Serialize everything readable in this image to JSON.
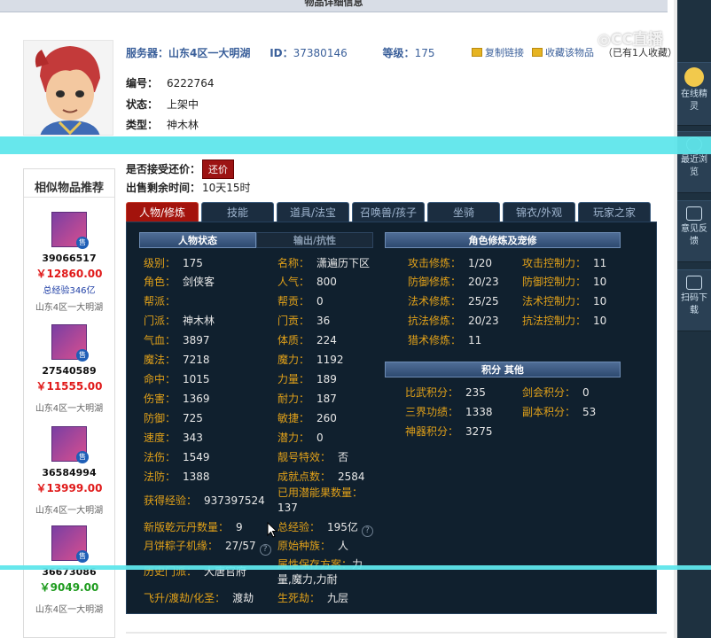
{
  "header": {
    "title": "物品详细信息"
  },
  "meta": {
    "server_label": "服务器：",
    "server": "山东4区一大明湖",
    "id_label": "ID：",
    "id": "37380146",
    "level_label": "等级：",
    "level": "175",
    "copy_link": "复制链接",
    "favorite": "收藏该物品",
    "favorite_count": "（已有1人收藏）"
  },
  "info": {
    "number_label": "编号：",
    "number": "6222764",
    "status_label": "状态：",
    "status": "上架中",
    "type_label": "类型：",
    "type": "神木林",
    "bargain_label": "是否接受还价：",
    "bargain_button": "还价",
    "remaining_label": "出售剩余时间：",
    "remaining": "10天15时"
  },
  "sidebar": {
    "title": "相似物品推荐",
    "items": [
      {
        "id": "39066517",
        "price": "￥12860.00",
        "exp": "总经验346亿",
        "server": "山东4区一大明湖",
        "price_color": "#e01a1a"
      },
      {
        "id": "27540589",
        "price": "￥11555.00",
        "exp": "",
        "server": "山东4区一大明湖",
        "price_color": "#e01a1a"
      },
      {
        "id": "36584994",
        "price": "￥13999.00",
        "exp": "",
        "server": "山东4区一大明湖",
        "price_color": "#e01a1a"
      },
      {
        "id": "36673086",
        "price": "￥9049.00",
        "exp": "",
        "server": "山东4区一大明湖",
        "price_color": "#1d9b1d"
      }
    ],
    "sell_badge": "售"
  },
  "tabs": [
    "人物/修炼",
    "技能",
    "道具/法宝",
    "召唤兽/孩子",
    "坐骑",
    "锦衣/外观",
    "玩家之家"
  ],
  "subtabs": {
    "character": "人物状态",
    "output": "输出/抗性",
    "cultivation": "角色修炼及宠修",
    "points": "积分 其他"
  },
  "character": {
    "left": [
      {
        "k": "级别：",
        "v": "175"
      },
      {
        "k": "角色：",
        "v": "剑侠客"
      },
      {
        "k": "帮派：",
        "v": ""
      },
      {
        "k": "门派：",
        "v": "神木林"
      },
      {
        "k": "气血：",
        "v": "3897"
      },
      {
        "k": "魔法：",
        "v": "7218"
      },
      {
        "k": "命中：",
        "v": "1015"
      },
      {
        "k": "伤害：",
        "v": "1369"
      },
      {
        "k": "防御：",
        "v": "725"
      },
      {
        "k": "速度：",
        "v": "343"
      },
      {
        "k": "法伤：",
        "v": "1549"
      },
      {
        "k": "法防：",
        "v": "1388"
      }
    ],
    "right": [
      {
        "k": "名称：",
        "v": "潇遍历下区"
      },
      {
        "k": "人气：",
        "v": "800"
      },
      {
        "k": "帮贡：",
        "v": "0"
      },
      {
        "k": "门贡：",
        "v": "36"
      },
      {
        "k": "体质：",
        "v": "224"
      },
      {
        "k": "魔力：",
        "v": "1192"
      },
      {
        "k": "力量：",
        "v": "189"
      },
      {
        "k": "耐力：",
        "v": "187"
      },
      {
        "k": "敏捷：",
        "v": "260"
      },
      {
        "k": "潜力：",
        "v": "0"
      },
      {
        "k": "靓号特效：",
        "v": "否"
      },
      {
        "k": "成就点数：",
        "v": "2584"
      }
    ],
    "exp_k": "获得经验：",
    "exp_v": "937397524",
    "potential_k": "已用潜能果数量：",
    "potential_v": "137",
    "qianyuan_k": "新版乾元丹数量：",
    "qianyuan_v": "9",
    "total_exp_k": "总经验：",
    "total_exp_v": "195亿",
    "zongzi_k": "月饼粽子机缘：",
    "zongzi_v": "27/57",
    "race_k": "原始种族：",
    "race_v": "人",
    "history_k": "历史门派：",
    "history_v": "大唐官府",
    "attr_k": "属性保存方案：",
    "attr_v": "力量,魔力,力耐",
    "fly_k": "飞升/渡劫/化圣：",
    "fly_v": "渡劫",
    "life_k": "生死劫：",
    "life_v": "九层"
  },
  "cultivation": {
    "left": [
      {
        "k": "攻击修炼：",
        "v": "1/20"
      },
      {
        "k": "防御修炼：",
        "v": "20/23"
      },
      {
        "k": "法术修炼：",
        "v": "25/25"
      },
      {
        "k": "抗法修炼：",
        "v": "20/23"
      },
      {
        "k": "猎术修炼：",
        "v": "11"
      }
    ],
    "right": [
      {
        "k": "攻击控制力：",
        "v": "11"
      },
      {
        "k": "防御控制力：",
        "v": "10"
      },
      {
        "k": "法术控制力：",
        "v": "10"
      },
      {
        "k": "抗法控制力：",
        "v": "10"
      }
    ]
  },
  "points": {
    "left": [
      {
        "k": "比武积分：",
        "v": "235"
      },
      {
        "k": "三界功绩：",
        "v": "1338"
      },
      {
        "k": "神器积分：",
        "v": "3275"
      }
    ],
    "right": [
      {
        "k": "剑会积分：",
        "v": "0"
      },
      {
        "k": "副本积分：",
        "v": "53"
      }
    ]
  },
  "right_sidebar": {
    "online": "在线精灵",
    "recent": "最近浏览",
    "feedback": "意见反馈",
    "scan": "扫码下载"
  },
  "watermark": "CC直播",
  "help_glyph": "?"
}
